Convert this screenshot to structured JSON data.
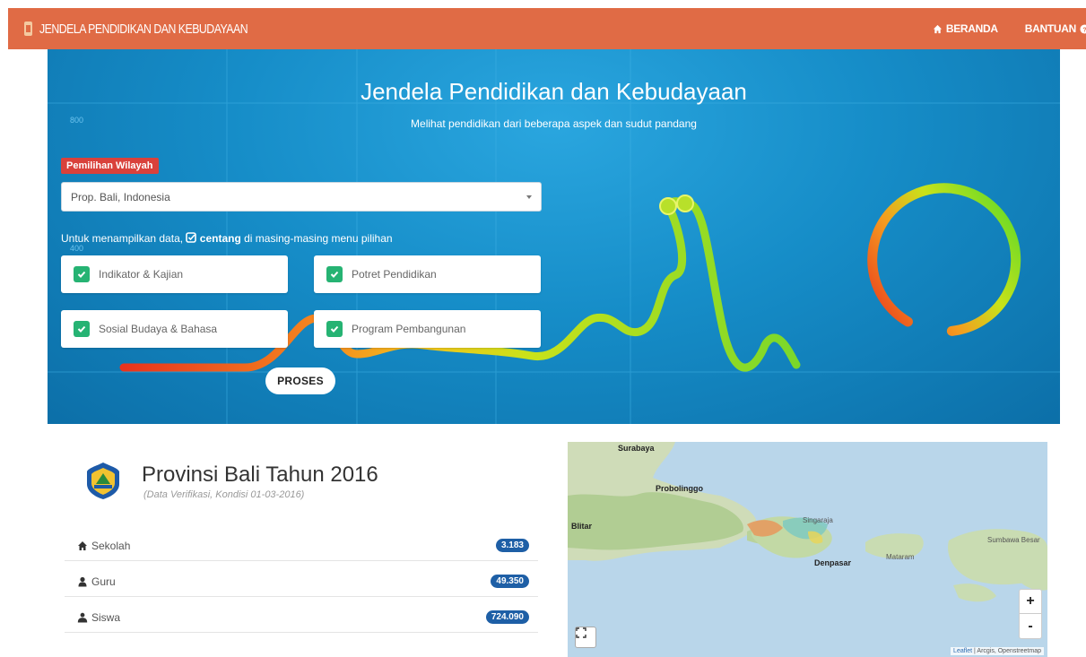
{
  "navbar": {
    "brand": "JENDELA PENDIDIKAN DAN KEBUDAYAAN",
    "links": [
      {
        "label": "BERANDA",
        "icon": "home-icon"
      },
      {
        "label": "BANTUAN",
        "icon": "help-icon"
      }
    ]
  },
  "hero": {
    "title": "Jendela Pendidikan dan Kebudayaan",
    "subtitle": "Melihat pendidikan dari beberapa aspek dan sudut pandang",
    "wilayah_label": "Pemilihan Wilayah",
    "region_value": "Prop. Bali, Indonesia",
    "hint_before": "Untuk menampilkan data,",
    "hint_bold": "centang",
    "hint_after": "di masing-masing menu pilihan",
    "options": [
      {
        "label": "Indikator & Kajian",
        "checked": true
      },
      {
        "label": "Potret Pendidikan",
        "checked": true
      },
      {
        "label": "Sosial Budaya & Bahasa",
        "checked": true
      },
      {
        "label": "Program Pembangunan",
        "checked": true
      }
    ],
    "proses_label": "PROSES",
    "bg_axis": [
      "800",
      "400",
      "200"
    ]
  },
  "summary": {
    "title": "Provinsi Bali Tahun 2016",
    "subtitle": "(Data Verifikasi, Kondisi 01-03-2016)",
    "stats": [
      {
        "label": "Sekolah",
        "value": "3.183",
        "icon": "home-icon"
      },
      {
        "label": "Guru",
        "value": "49.350",
        "icon": "user-icon"
      },
      {
        "label": "Siswa",
        "value": "724.090",
        "icon": "users-icon"
      }
    ]
  },
  "map": {
    "labels": [
      "Surabaya",
      "Probolinggo",
      "Blitar",
      "Denpasar",
      "Singaraja",
      "Mataram",
      "Sumbawa Besar"
    ],
    "zoom_in": "+",
    "zoom_out": "-",
    "attribution_link": "Leaflet",
    "attribution_text": " | Arcgis, Openstreetmap"
  },
  "colors": {
    "navbar": "#e06b45",
    "hero_blue": "#168dc8",
    "badge": "#1e5fa6",
    "check_green": "#26b373",
    "wilayah_red": "#d9413b"
  }
}
